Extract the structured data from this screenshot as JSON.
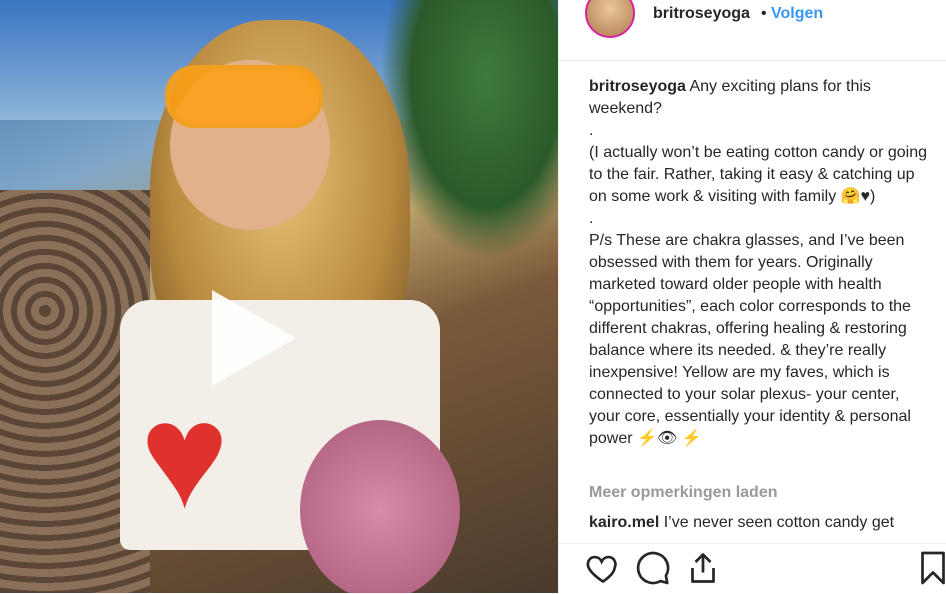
{
  "post": {
    "video": {
      "play_icon": "play-icon"
    }
  },
  "header": {
    "username": "britroseyoga",
    "dot": "•",
    "follow_label": "Volgen"
  },
  "caption": {
    "username": "britroseyoga",
    "lines": [
      "Any exciting plans for this weekend?",
      ".",
      "(I actually won’t be eating cotton candy or going to the fair. Rather, taking it easy & catching up on some work & visiting with family 🤗♥)",
      ".",
      "P/s These are chakra glasses, and I’ve been obsessed with them for years. Originally marketed toward older people with health “opportunities”, each color corresponds to the different chakras, offering healing & restoring balance where its needed. & they’re really inexpensive! Yellow are my faves, which is connected to your solar plexus- your center, your core, essentially your identity & personal power ⚡👁 ⚡"
    ]
  },
  "load_more_label": "Meer opmerkingen laden",
  "comment": {
    "username": "kairo.mel",
    "text": "I’ve never seen cotton candy get"
  },
  "actions": [
    "heart-icon",
    "comment-icon",
    "share-icon",
    "bookmark-icon"
  ]
}
